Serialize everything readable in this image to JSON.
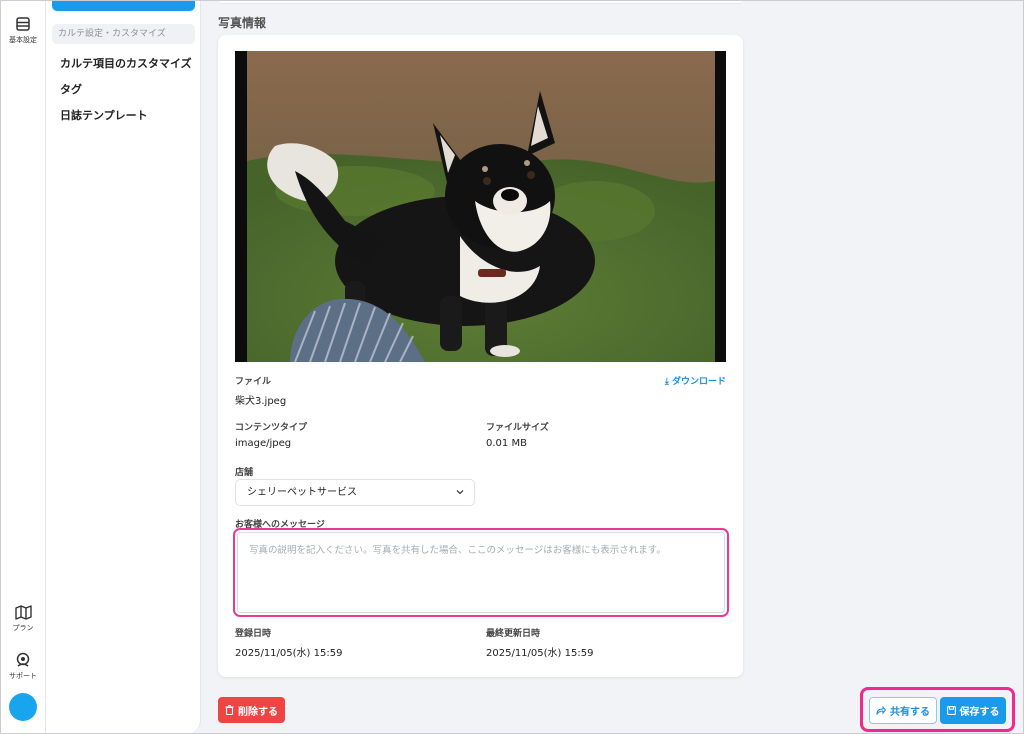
{
  "rail": {
    "items": [
      {
        "label": "基本設定",
        "icon": "store-icon"
      },
      {
        "label": "プラン",
        "icon": "map-icon"
      },
      {
        "label": "サポート",
        "icon": "support-icon"
      }
    ],
    "avatar_color": "#19a4ee"
  },
  "submenu": {
    "section_label": "カルテ設定・カスタマイズ",
    "items": [
      {
        "label": "カルテ項目のカスタマイズ"
      },
      {
        "label": "タグ"
      },
      {
        "label": "日誌テンプレート"
      }
    ]
  },
  "photo_info": {
    "section_title": "写真情報",
    "photo_alt": "柴犬の写真",
    "file_label": "ファイル",
    "file_name": "柴犬3.jpeg",
    "download_label": "ダウンロード",
    "content_type_label": "コンテンツタイプ",
    "content_type": "image/jpeg",
    "file_size_label": "ファイルサイズ",
    "file_size": "0.01 MB",
    "store_label": "店舗",
    "store_value": "シェリーペットサービス",
    "message_label": "お客様へのメッセージ",
    "message_placeholder": "写真の説明を記入ください。写真を共有した場合、ここのメッセージはお客様にも表示されます。",
    "message_value": "",
    "created_label": "登録日時",
    "created_value": "2025/11/05(水) 15:59",
    "updated_label": "最終更新日時",
    "updated_value": "2025/11/05(水) 15:59"
  },
  "actions": {
    "delete_label": "削除する",
    "share_label": "共有する",
    "save_label": "保存する"
  },
  "colors": {
    "accent": "#1a9bea",
    "danger": "#ef4444",
    "highlight": "#ee2b8c"
  }
}
